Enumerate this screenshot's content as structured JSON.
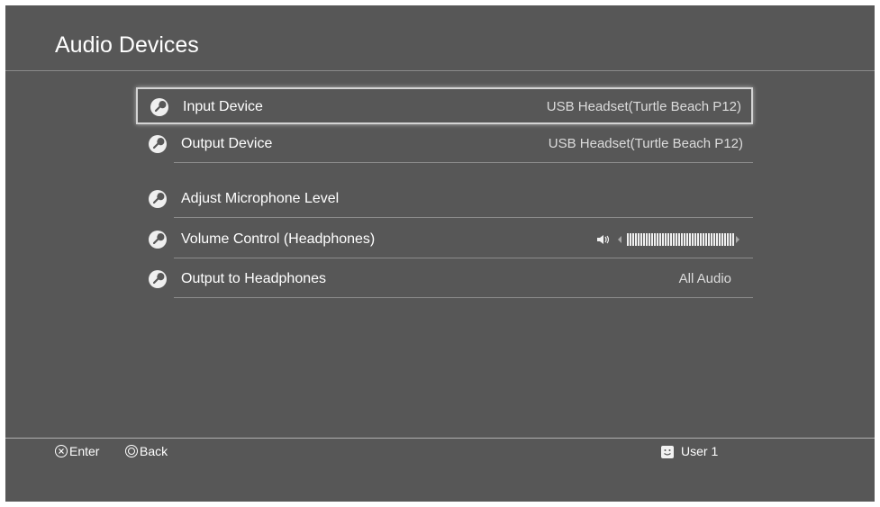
{
  "page": {
    "title": "Audio Devices"
  },
  "menu": [
    {
      "icon": "wrench-icon",
      "label": "Input Device",
      "value": "USB Headset(Turtle Beach P12)",
      "selected": true
    },
    {
      "icon": "wrench-icon",
      "label": "Output Device",
      "value": "USB Headset(Turtle Beach P12)"
    },
    {
      "icon": "wrench-icon",
      "label": "Adjust Microphone Level",
      "value": ""
    },
    {
      "icon": "wrench-icon",
      "label": "Volume Control (Headphones)",
      "value": "",
      "volume_level": 1.0
    },
    {
      "icon": "wrench-icon",
      "label": "Output to Headphones",
      "value": "All Audio"
    }
  ],
  "footer": {
    "enter_label": "Enter",
    "back_label": "Back",
    "user_label": "User 1",
    "enter_icon": "cross-button-icon",
    "back_icon": "circle-button-icon",
    "user_icon": "user-face-icon"
  },
  "colors": {
    "background": "#575757",
    "text": "#ffffff",
    "selection_border": "#d4d4d4"
  }
}
